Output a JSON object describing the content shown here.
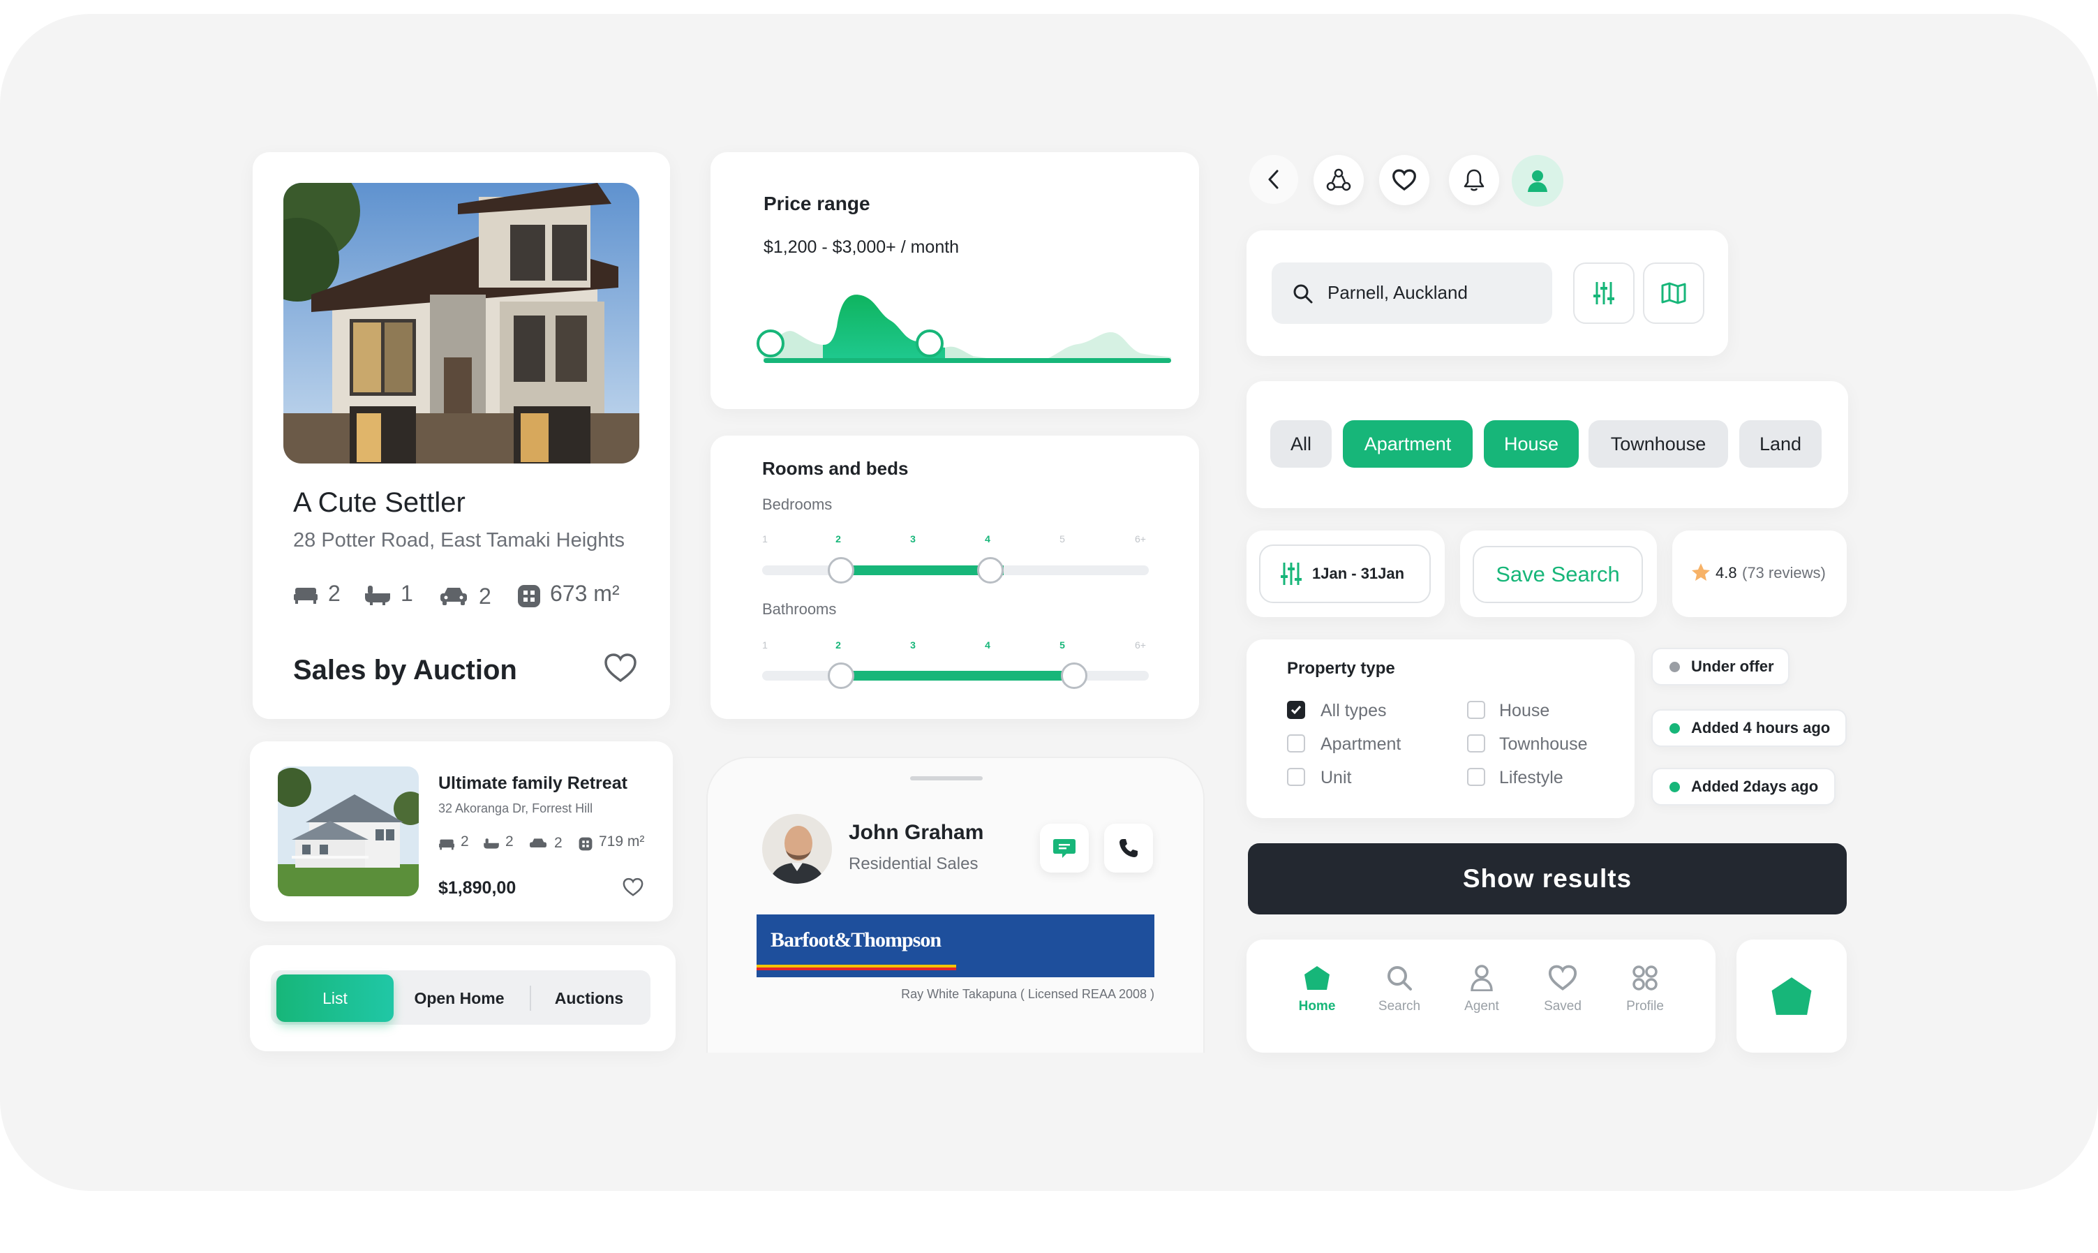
{
  "theme": {
    "accent": "#17b679",
    "dark": "#1f2328",
    "muted": "#6c7077",
    "brand_blue": "#1e4f9c"
  },
  "listing": {
    "title": "A Cute Settler",
    "address": "28 Potter Road, East Tamaki Heights",
    "beds": "2",
    "baths": "1",
    "cars": "2",
    "area": "673 m²",
    "sale_method": "Sales by Auction"
  },
  "listing_small": {
    "title": "Ultimate family Retreat",
    "address": "32 Akoranga Dr, Forrest Hill",
    "beds": "2",
    "baths": "2",
    "cars": "2",
    "area": "719 m²",
    "price": "$1,890,00"
  },
  "view_tabs": [
    "List",
    "Open Home",
    "Auctions"
  ],
  "price_range": {
    "title": "Price range",
    "value": "$1,200 - $3,000+ / month",
    "low_fraction": 0.15,
    "high_fraction": 0.54
  },
  "rooms": {
    "title": "Rooms and beds",
    "bedrooms_label": "Bedrooms",
    "bathrooms_label": "Bathrooms",
    "ticks": [
      "1",
      "2",
      "3",
      "4",
      "5",
      "6+"
    ],
    "bedrooms_range": [
      "2",
      "4"
    ],
    "bathrooms_range": [
      "2",
      "5"
    ]
  },
  "agent": {
    "name": "John Graham",
    "role": "Residential Sales",
    "brand": "Barfoot&Thompson",
    "license": "Ray White Takapuna ( Licensed REAA 2008 )"
  },
  "top_icons": [
    "back-arrow-icon",
    "share-icon",
    "heart-icon",
    "bell-icon",
    "user-icon"
  ],
  "search": {
    "value": "Parnell, Auckland"
  },
  "type_chips": [
    {
      "label": "All",
      "active": false
    },
    {
      "label": "Apartment",
      "active": true
    },
    {
      "label": "House",
      "active": true
    },
    {
      "label": "Townhouse",
      "active": false
    },
    {
      "label": "Land",
      "active": false
    }
  ],
  "date_filter": "1Jan - 31Jan",
  "save_search": "Save Search",
  "rating": {
    "score": "4.8",
    "reviews": "(73 reviews)"
  },
  "property_type": {
    "title": "Property type",
    "options": [
      {
        "label": "All types",
        "checked": true
      },
      {
        "label": "House",
        "checked": false
      },
      {
        "label": "Apartment",
        "checked": false
      },
      {
        "label": "Townhouse",
        "checked": false
      },
      {
        "label": "Unit",
        "checked": false
      },
      {
        "label": "Lifestyle",
        "checked": false
      }
    ]
  },
  "statuses": [
    {
      "label": "Under offer",
      "color": "#9a9ea4"
    },
    {
      "label": "Added 4 hours ago",
      "color": "#17b679"
    },
    {
      "label": "Added 2days ago",
      "color": "#17b679"
    }
  ],
  "show_results": "Show results",
  "bottom_nav": [
    {
      "label": "Home",
      "icon": "home-icon",
      "active": true
    },
    {
      "label": "Search",
      "icon": "search-icon",
      "active": false
    },
    {
      "label": "Agent",
      "icon": "agent-icon",
      "active": false
    },
    {
      "label": "Saved",
      "icon": "saved-icon",
      "active": false
    },
    {
      "label": "Profile",
      "icon": "profile-grid-icon",
      "active": false
    }
  ]
}
